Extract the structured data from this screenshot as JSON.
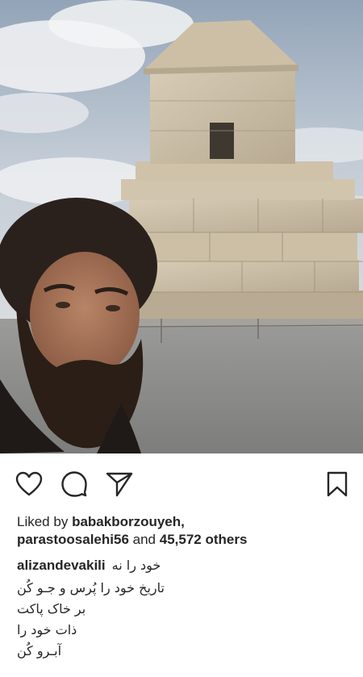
{
  "post": {
    "photo_alt": "",
    "actions": {
      "like_icon": "heart-outline-icon",
      "comment_icon": "speech-bubble-icon",
      "share_icon": "paper-plane-icon",
      "save_icon": "bookmark-outline-icon"
    },
    "likes": {
      "prefix": "Liked by",
      "user1": "babakborzouyeh,",
      "user2": "parastoosalehi56",
      "and": "and",
      "count": "45,572 others"
    },
    "caption": {
      "username": "alizandevakili",
      "lines": [
        "خود را نه",
        "تاریخ خود را پُرس و جـو کُن",
        "بر خاک پاکت",
        "ذات خود را",
        "آبـرو کُن"
      ]
    }
  }
}
